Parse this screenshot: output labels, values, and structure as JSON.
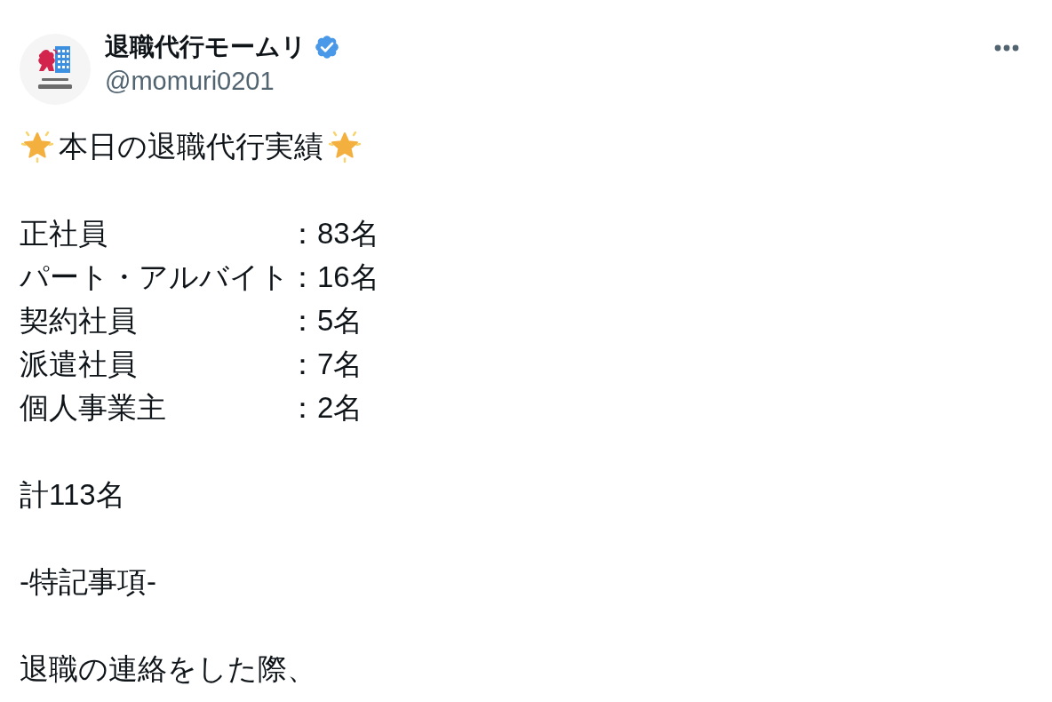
{
  "account": {
    "name": "退職代行モームリ",
    "verified": true,
    "handle": "@momuri0201"
  },
  "post": {
    "title": "本日の退職代行実績",
    "breakdown": [
      {
        "label": "正社員",
        "value": "：83名"
      },
      {
        "label": "パート・アルバイト",
        "value": "：16名"
      },
      {
        "label": "契約社員",
        "value": "：5名"
      },
      {
        "label": "派遣社員",
        "value": "：7名"
      },
      {
        "label": "個人事業主",
        "value": "：2名"
      }
    ],
    "total": "計113名",
    "section_heading": "-特記事項-",
    "paragraph": "退職の連絡をした際、"
  }
}
